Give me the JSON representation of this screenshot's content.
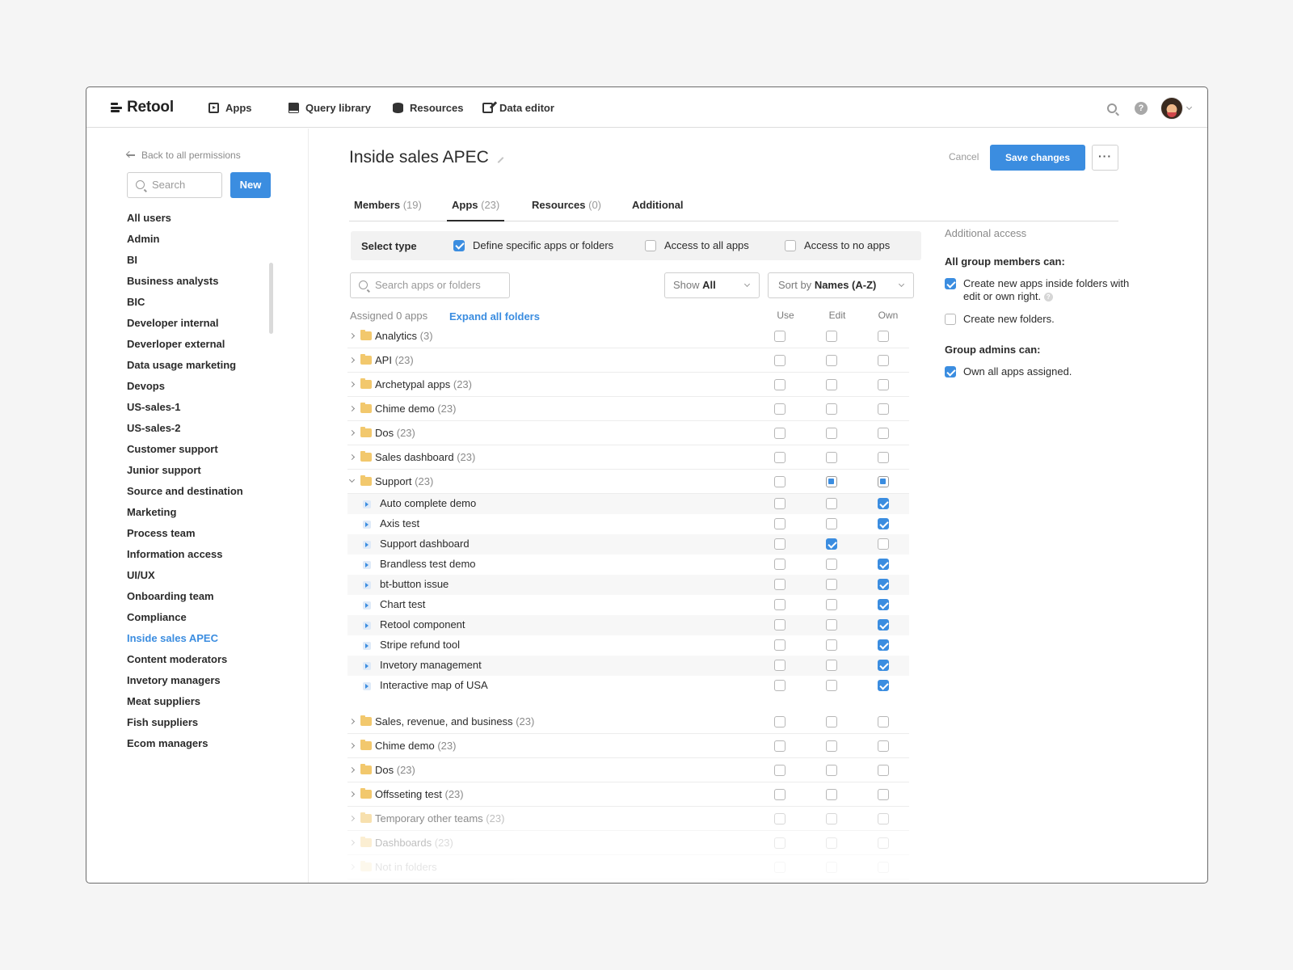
{
  "brand": "Retool",
  "nav": [
    "Apps",
    "Query library",
    "Resources",
    "Data editor"
  ],
  "sidebar": {
    "back_label": "Back to all permissions",
    "search_placeholder": "Search",
    "new_label": "New",
    "groups": [
      "All users",
      "Admin",
      "BI",
      "Business analysts",
      "BIC",
      "Developer internal",
      "Deverloper external",
      "Data usage marketing",
      "Devops",
      "US-sales-1",
      "US-sales-2",
      "Customer support",
      "Junior support",
      "Source and destination",
      "Marketing",
      "Process team",
      "Information access",
      "UI/UX",
      "Onboarding team",
      "Compliance",
      "Inside sales APEC",
      "Content moderators",
      "Invetory managers",
      "Meat suppliers",
      "Fish suppliers",
      "Ecom managers"
    ],
    "active_group": "Inside sales APEC"
  },
  "page": {
    "title": "Inside sales APEC",
    "cancel_label": "Cancel",
    "save_label": "Save changes",
    "more_label": "···"
  },
  "tabs": [
    {
      "label": "Members",
      "count": "(19)"
    },
    {
      "label": "Apps",
      "count": "(23)"
    },
    {
      "label": "Resources",
      "count": "(0)"
    },
    {
      "label": "Additional",
      "count": ""
    }
  ],
  "active_tab": "Apps",
  "select_type": {
    "label": "Select type",
    "options": [
      {
        "label": "Define specific apps or folders",
        "checked": true
      },
      {
        "label": "Access to all apps",
        "checked": false
      },
      {
        "label": "Access to no apps",
        "checked": false
      }
    ]
  },
  "filters": {
    "search_placeholder": "Search apps or folders",
    "show_prefix": "Show",
    "show_value": "All",
    "sort_prefix": "Sort by",
    "sort_value": "Names (A-Z)"
  },
  "list": {
    "assigned_label": "Assigned 0 apps",
    "expand_label": "Expand all folders",
    "columns": [
      "Use",
      "Edit",
      "Own"
    ],
    "rows": [
      {
        "type": "folder",
        "name": "Analytics",
        "count": "(3)",
        "state": [
          "off",
          "off",
          "off"
        ]
      },
      {
        "type": "folder",
        "name": "API",
        "count": "(23)",
        "state": [
          "off",
          "off",
          "off"
        ]
      },
      {
        "type": "folder",
        "name": "Archetypal apps",
        "count": "(23)",
        "state": [
          "off",
          "off",
          "off"
        ]
      },
      {
        "type": "folder",
        "name": "Chime demo",
        "count": "(23)",
        "state": [
          "off",
          "off",
          "off"
        ]
      },
      {
        "type": "folder",
        "name": "Dos",
        "count": "(23)",
        "state": [
          "off",
          "off",
          "off"
        ]
      },
      {
        "type": "folder",
        "name": "Sales dashboard",
        "count": "(23)",
        "state": [
          "off",
          "off",
          "off"
        ]
      },
      {
        "type": "folder",
        "name": "Support",
        "count": "(23)",
        "open": true,
        "state": [
          "off",
          "partial",
          "partial"
        ]
      },
      {
        "type": "app",
        "name": "Auto complete demo",
        "state": [
          "off",
          "off",
          "on"
        ]
      },
      {
        "type": "app",
        "name": "Axis test",
        "state": [
          "off",
          "off",
          "on"
        ]
      },
      {
        "type": "app",
        "name": "Support dashboard",
        "state": [
          "off",
          "on",
          "off"
        ]
      },
      {
        "type": "app",
        "name": "Brandless test demo",
        "state": [
          "off",
          "off",
          "on"
        ]
      },
      {
        "type": "app",
        "name": "bt-button issue",
        "state": [
          "off",
          "off",
          "on"
        ]
      },
      {
        "type": "app",
        "name": "Chart test",
        "state": [
          "off",
          "off",
          "on"
        ]
      },
      {
        "type": "app",
        "name": "Retool component",
        "state": [
          "off",
          "off",
          "on"
        ]
      },
      {
        "type": "app",
        "name": "Stripe refund tool",
        "state": [
          "off",
          "off",
          "on"
        ]
      },
      {
        "type": "app",
        "name": "Invetory management",
        "state": [
          "off",
          "off",
          "on"
        ]
      },
      {
        "type": "app",
        "name": "Interactive map of USA",
        "state": [
          "off",
          "off",
          "on"
        ]
      },
      {
        "type": "folder",
        "name": "Sales, revenue, and business",
        "count": "(23)",
        "state": [
          "off",
          "off",
          "off"
        ]
      },
      {
        "type": "folder",
        "name": "Chime demo",
        "count": "(23)",
        "state": [
          "off",
          "off",
          "off"
        ]
      },
      {
        "type": "folder",
        "name": "Dos",
        "count": "(23)",
        "state": [
          "off",
          "off",
          "off"
        ]
      },
      {
        "type": "folder",
        "name": "Offsseting test",
        "count": "(23)",
        "state": [
          "off",
          "off",
          "off"
        ]
      },
      {
        "type": "folder",
        "name": "Temporary other teams",
        "count": "(23)",
        "state": [
          "off",
          "off",
          "off"
        ]
      },
      {
        "type": "folder",
        "name": "Dashboards",
        "count": "(23)",
        "state": [
          "off",
          "off",
          "off"
        ]
      },
      {
        "type": "folder",
        "name": "Not in folders",
        "count": "",
        "state": [
          "off",
          "off",
          "off"
        ]
      }
    ]
  },
  "additional": {
    "title": "Additional access",
    "members_heading": "All group members can:",
    "member_options": [
      {
        "label": "Create new apps inside folders with edit or own right.",
        "checked": true,
        "help": "?"
      },
      {
        "label": "Create new folders.",
        "checked": false
      }
    ],
    "admins_heading": "Group admins can:",
    "admin_options": [
      {
        "label": "Own all apps assigned.",
        "checked": true
      }
    ]
  },
  "colors": {
    "accent": "#3b8de0",
    "folder": "#f2c86d"
  }
}
